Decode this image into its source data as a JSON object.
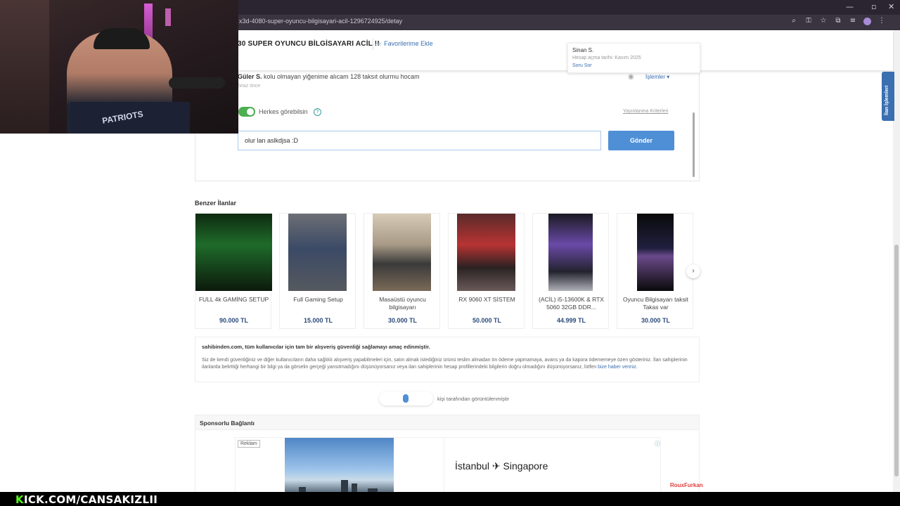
{
  "browser": {
    "url": "x3d-4080-super-oyuncu-bilgisayari-acil-1296724925/detay",
    "window_controls": [
      "—",
      "▫",
      "✕"
    ]
  },
  "header": {
    "title": "30 SUPER OYUNCU BİLGİSAYARI ACİL !!",
    "favorite_label": "Favorilerime Ekle"
  },
  "seller": {
    "name": "Sinan S.",
    "joined": "Hesap açma tarihi: Kasım 2025",
    "ask_link": "Soru Sor"
  },
  "question": {
    "author": "Güler S.",
    "text": "kolu olmayan yiğenime alıcam 128 taksıt olurmu hocam",
    "time": "biraz önce",
    "actions_label": "İşlemler",
    "visibility_label": "Herkes görebilsin",
    "criteria_link": "Yayınlanma Kriterleri",
    "answer_value": "olur lan aslkdjsa :D",
    "send_label": "Gönder"
  },
  "side_tab": {
    "label": "İlan İşlemleri"
  },
  "similar": {
    "title": "Benzer İlanlar",
    "items": [
      {
        "name": "FULL 4k GAMİNG SETUP",
        "price": "90.000 TL"
      },
      {
        "name": "Full Gaming Setup",
        "price": "15.000 TL"
      },
      {
        "name": "Masaüstü oyuncu bilgisayarı",
        "price": "30.000 TL"
      },
      {
        "name": "RX 9060 XT SİSTEM",
        "price": "50.000 TL"
      },
      {
        "name": "(ACİL) i5-13600K & RTX 5060 32GB DDR...",
        "price": "44.999 TL"
      },
      {
        "name": "Oyuncu Bilgisayarı taksit Takas var",
        "price": "30.000 TL"
      }
    ]
  },
  "notice": {
    "heading": "sahibinden.com, tüm kullanıcılar için tam bir alışveriş güvenliği sağlamayı amaç edinmiştir.",
    "body": "Siz de kendi güvenliğiniz ve diğer kullanıcıların daha sağlıklı alışveriş yapabilmeleri için, satın almak istediğiniz ürünü teslim almadan ön ödeme yapmamaya, avans ya da kapora ödememeye özen gösteriniz. İlan sahiplerinin ilanlarda belirttiği herhangi bir bilgi ya da görselin gerçeği yansıtmadığını düşünüyorsanız veya ilan sahiplerinin hesap profillerindeki bilgilerin doğru olmadığını düşünüyorsanız, lütfen",
    "link": "bize haber veriniz."
  },
  "views": {
    "text": "kişi tarafından görüntülenmiştir"
  },
  "sponsored": {
    "title": "Sponsorlu Bağlantı",
    "ad_badge": "Reklam",
    "ad_text": "İstanbul ✈ Singapore"
  },
  "overlay": {
    "kick_prefix": "K",
    "kick_text": "ICK.COM/CANSAKIZLII",
    "shirt_text": "PATRIOTS",
    "watermark_brand": "RouxFurkan"
  },
  "colors": {
    "accent": "#3a6fb0",
    "button": "#4f8fd6",
    "toggle_on": "#4caf50",
    "kick_green": "#53fc18"
  }
}
